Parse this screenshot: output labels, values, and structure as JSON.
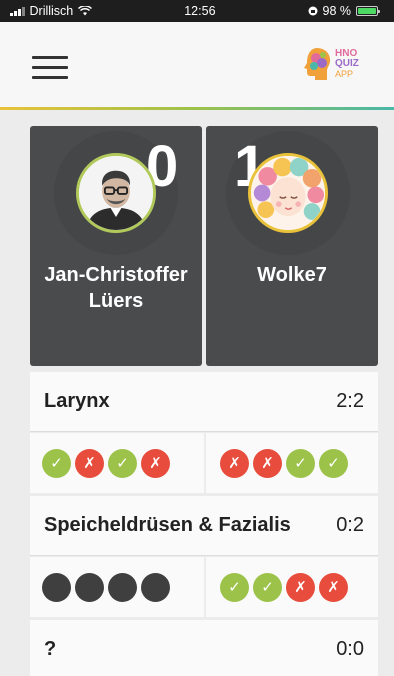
{
  "status_bar": {
    "carrier": "Drillisch",
    "time": "12:56",
    "battery": "98 %",
    "battery_level": 0.98
  },
  "app": {
    "logo_lines": [
      "HNO",
      "QUIZ",
      "APP"
    ]
  },
  "players": [
    {
      "name": "Jan-Christoffer Lüers",
      "score": "0"
    },
    {
      "name": "Wolke7",
      "score": "1"
    }
  ],
  "rounds": [
    {
      "category": "Larynx",
      "score": "2:2",
      "left": [
        "correct",
        "wrong",
        "correct",
        "wrong"
      ],
      "right": [
        "wrong",
        "wrong",
        "correct",
        "correct"
      ]
    },
    {
      "category": "Speicheldrüsen & Fazialis",
      "score": "0:2",
      "left": [
        "pending",
        "pending",
        "pending",
        "pending"
      ],
      "right": [
        "correct",
        "correct",
        "wrong",
        "wrong"
      ]
    },
    {
      "category": "?",
      "score": "0:0"
    }
  ],
  "symbols": {
    "correct": "✓",
    "wrong": "✗",
    "pending": ""
  },
  "colors": {
    "correct": "#9cc24a",
    "wrong": "#e74c3c",
    "pending": "#3f3f40",
    "card": "#4a4b4d"
  }
}
